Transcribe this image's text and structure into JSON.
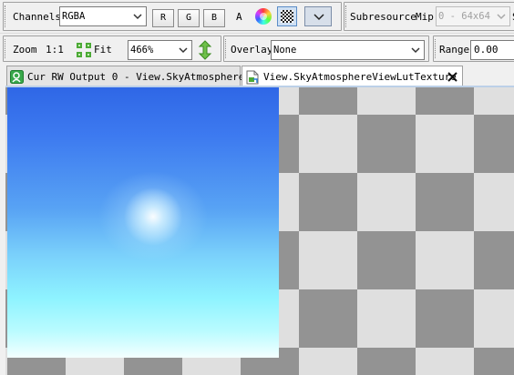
{
  "toolbar1": {
    "channels_label": "Channels",
    "channels_value": "RGBA",
    "btn_r": "R",
    "btn_g": "G",
    "btn_b": "B",
    "label_a": "A",
    "subresource_label": "Subresource",
    "mip_label": "Mip",
    "mip_value": "0 - 64x64",
    "overflow_label": "S"
  },
  "toolbar2": {
    "zoom_label": "Zoom",
    "zoom_ratio": "1:1",
    "fit_label": "Fit",
    "zoom_value": "466%",
    "overlay_label": "Overlay",
    "overlay_value": "None",
    "range_label": "Range",
    "range_value": "0.00"
  },
  "tabs": [
    {
      "label": "Cur RW Output 0 - View.SkyAtmosphere…",
      "icon": "texture-output-icon"
    },
    {
      "label": "View.SkyAtmosphereViewLutTexture",
      "icon": "texture-document-icon"
    }
  ],
  "colors": {
    "checker_dark": "#939393",
    "checker_light": "#dfdfdf",
    "sky_top": "#2f67e6",
    "sky_bottom": "#f4ffff",
    "active_tab_border": "#5b8dc7"
  }
}
